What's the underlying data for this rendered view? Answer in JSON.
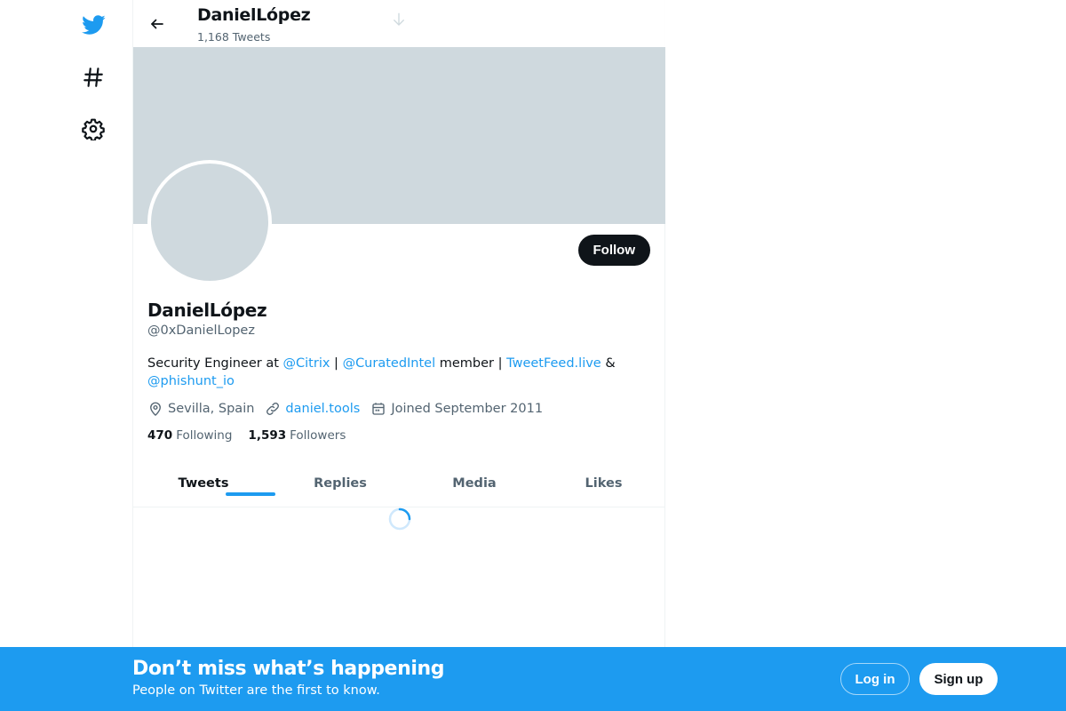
{
  "nav": {
    "logo_icon": "twitter-bird-icon",
    "explore_icon": "hashtag-icon",
    "settings_icon": "gear-icon"
  },
  "header": {
    "name": "DanielLópez",
    "tweet_count": "1,168 Tweets"
  },
  "profile": {
    "name": "DanielLópez",
    "handle": "@0xDanielLopez",
    "follow_label": "Follow",
    "bio": {
      "text1": "Security Engineer at ",
      "link1": "@Citrix",
      "sep1": " | ",
      "link2": "@CuratedIntel",
      "text2": " member | ",
      "link3": "TweetFeed.live",
      "text3": " & ",
      "link4": "@phishunt_io"
    },
    "location": "Sevilla, Spain",
    "website": "daniel.tools",
    "joined": "Joined September 2011",
    "following_count": "470",
    "following_label": "Following",
    "followers_count": "1,593",
    "followers_label": "Followers"
  },
  "tabs": [
    {
      "label": "Tweets",
      "active": true
    },
    {
      "label": "Replies"
    },
    {
      "label": "Media"
    },
    {
      "label": "Likes"
    }
  ],
  "bottom_bar": {
    "title": "Don’t miss what’s happening",
    "subtitle": "People on Twitter are the first to know.",
    "login_label": "Log in",
    "signup_label": "Sign up"
  },
  "colors": {
    "accent": "#1d9bf0",
    "text": "#0f1419",
    "muted": "#536471",
    "placeholder": "#cfd9de"
  }
}
